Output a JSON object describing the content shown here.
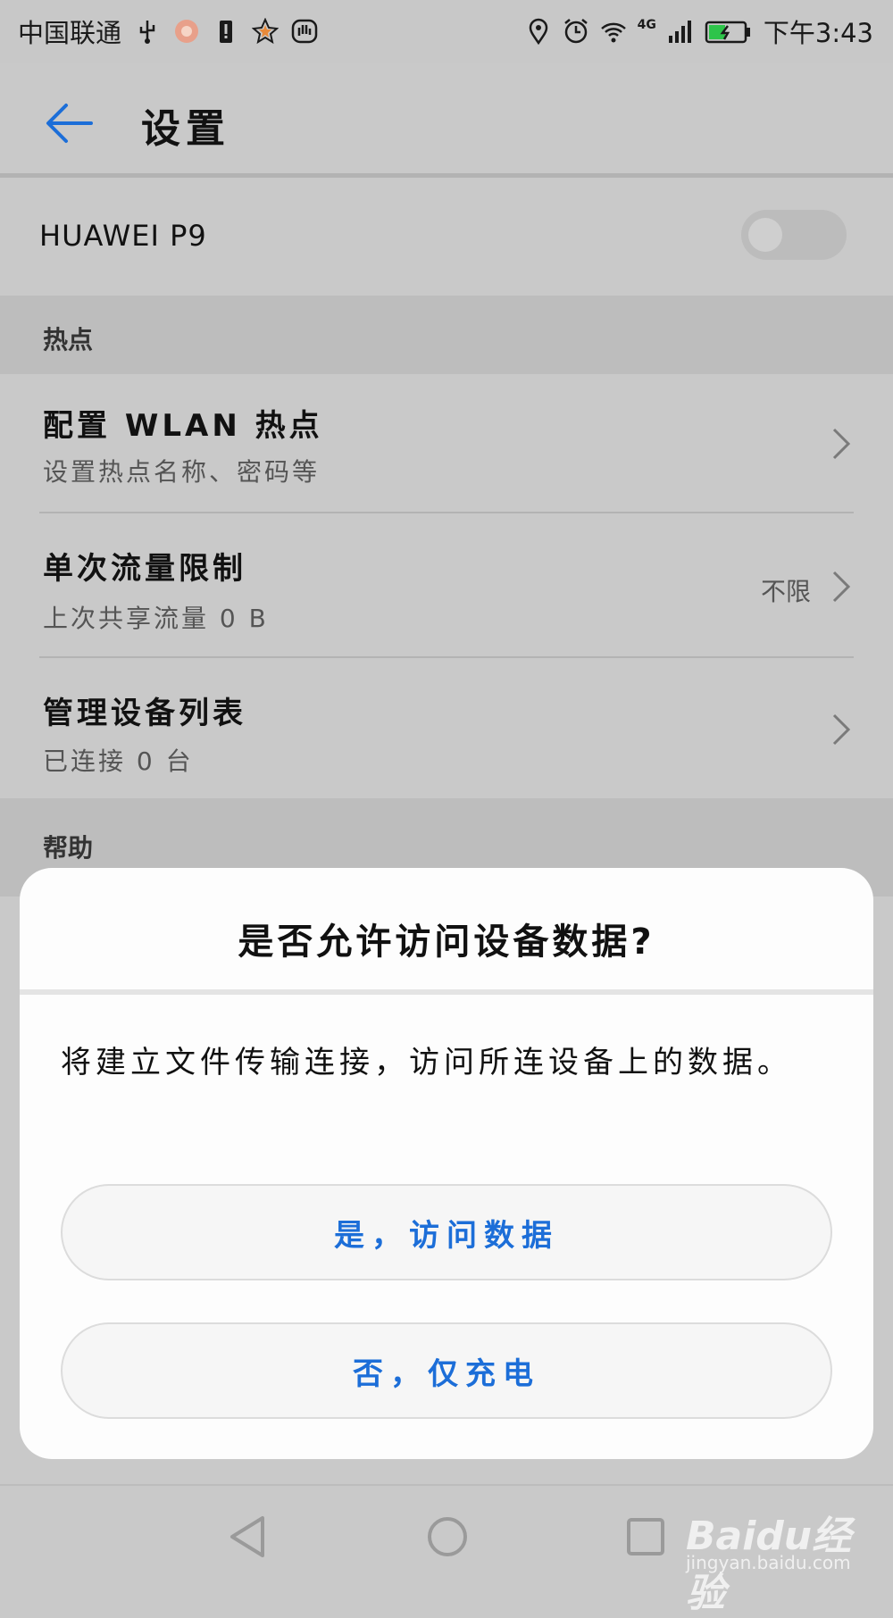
{
  "status_bar": {
    "carrier": "中国联通",
    "network": "4G",
    "time": "下午3:43",
    "icons_left": [
      "usb-icon",
      "app-notification-icon",
      "battery-alert-icon",
      "star-icon",
      "hand-icon"
    ],
    "icons_right": [
      "location-icon",
      "alarm-icon",
      "wifi-icon",
      "signal-icon",
      "battery-charging-icon"
    ]
  },
  "header": {
    "title": "设置",
    "back_icon": "back-arrow-icon",
    "accent": "#1c6ed8"
  },
  "device": {
    "name": "HUAWEI P9",
    "toggle_on": false
  },
  "sections": {
    "hotspot": "热点",
    "help": "帮助"
  },
  "rows": [
    {
      "title": "配置 WLAN 热点",
      "subtitle": "设置热点名称、密码等",
      "value": ""
    },
    {
      "title": "单次流量限制",
      "subtitle": "上次共享流量 0 B",
      "value": "不限"
    },
    {
      "title": "管理设备列表",
      "subtitle": "已连接 0 台",
      "value": ""
    }
  ],
  "dialog": {
    "title": "是否允许访问设备数据?",
    "message": "将建立文件传输连接，访问所连设备上的数据。",
    "btn_yes": "是，访问数据",
    "btn_no": "否，仅充电"
  },
  "navbar": {
    "icons": [
      "back-triangle-icon",
      "home-circle-icon",
      "recents-square-icon"
    ]
  },
  "watermark": {
    "brand": "Baidu经验",
    "url": "jingyan.baidu.com"
  }
}
